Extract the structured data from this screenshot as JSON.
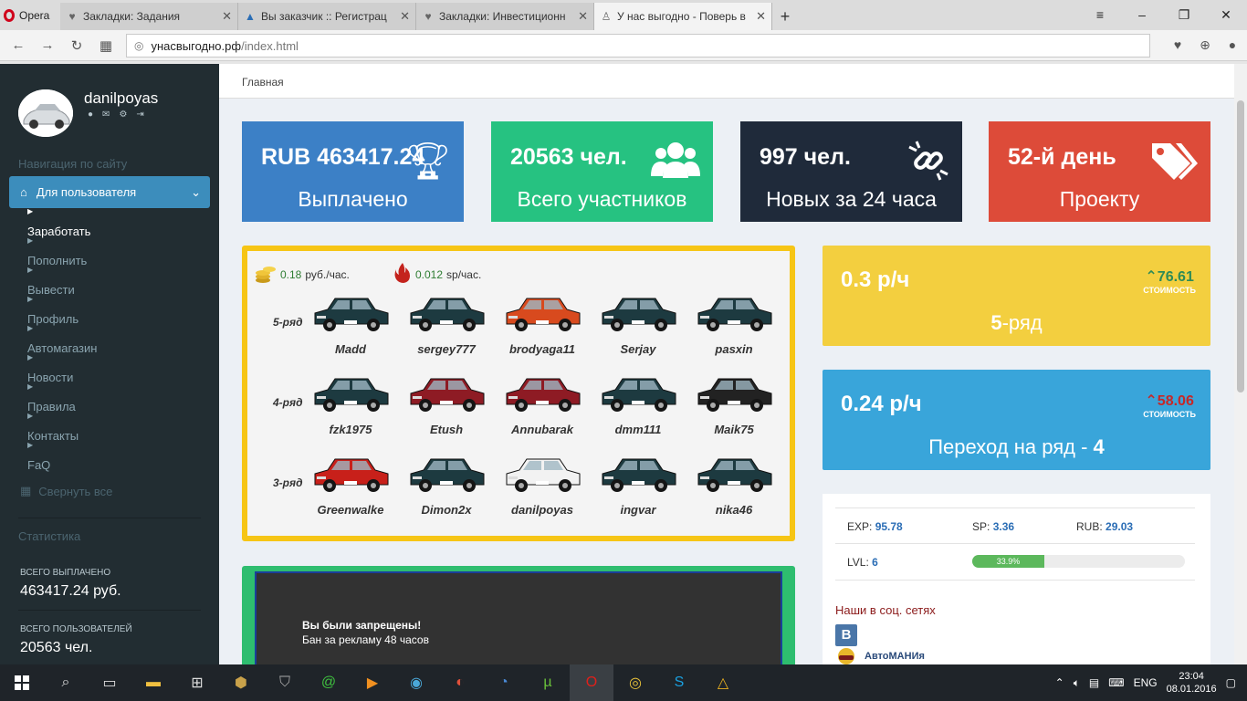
{
  "browser": {
    "menu_label": "Opera",
    "tabs": [
      {
        "title": "Закладки: Задания",
        "icon": "heart-icon"
      },
      {
        "title": "Вы заказчик :: Регистрац",
        "icon": "triangle-icon"
      },
      {
        "title": "Закладки: Инвестиционн",
        "icon": "heart-icon"
      },
      {
        "title": "У нас выгодно - Поверь в",
        "icon": "walker-icon"
      }
    ],
    "url_host": "унасвыгодно.рф",
    "url_path": "/index.html"
  },
  "sidebar": {
    "username": "danilpoyas",
    "nav_heading": "Навигация по сайту",
    "active_group": "Для пользователя",
    "items": [
      "Заработать",
      "Пополнить",
      "Вывести",
      "Профиль",
      "Автомагазин",
      "Новости",
      "Правила",
      "Контакты",
      "FaQ"
    ],
    "collapse_all": "Свернуть все",
    "stats_heading": "Статистика",
    "total_paid_label": "ВСЕГО ВЫПЛАЧЕНО",
    "total_paid_value": "463417.24 руб.",
    "total_users_label": "ВСЕГО ПОЛЬЗОВАТЕЛЕЙ",
    "total_users_value": "20563 чел."
  },
  "breadcrumb": "Главная",
  "kpis": [
    {
      "value": "RUB 463417.24",
      "label": "Выплачено",
      "color": "#3c80c6",
      "icon": "trophy-icon"
    },
    {
      "value": "20563 чел.",
      "label": "Всего участников",
      "color": "#26c281",
      "icon": "users-icon"
    },
    {
      "value": "997 чел.",
      "label": "Новых за 24 часа",
      "color": "#1f2a3a",
      "icon": "link-icon"
    },
    {
      "value": "52-й день",
      "label": "Проекту",
      "color": "#dd4b39",
      "icon": "tags-icon"
    }
  ],
  "rates": {
    "rub": "0.18",
    "rub_unit": "руб./час.",
    "sp": "0.012",
    "sp_unit": "sp/час."
  },
  "rows": [
    {
      "label": "5-ряд",
      "cars": [
        {
          "name": "Madd",
          "color": "#1d3a40"
        },
        {
          "name": "sergey777",
          "color": "#1d3a40"
        },
        {
          "name": "brodyaga11",
          "color": "#d84a1e"
        },
        {
          "name": "Serjay",
          "color": "#1d3a40"
        },
        {
          "name": "pasxin",
          "color": "#1d3a40"
        }
      ]
    },
    {
      "label": "4-ряд",
      "cars": [
        {
          "name": "fzk1975",
          "color": "#1d3a40"
        },
        {
          "name": "Etush",
          "color": "#8e1b24"
        },
        {
          "name": "Annubarak",
          "color": "#8e1b24"
        },
        {
          "name": "dmm111",
          "color": "#1d3a40"
        },
        {
          "name": "Maik75",
          "color": "#222222"
        }
      ]
    },
    {
      "label": "3-ряд",
      "cars": [
        {
          "name": "Greenwalke",
          "color": "#c8201a"
        },
        {
          "name": "Dimon2x",
          "color": "#1d3a40"
        },
        {
          "name": "danilpoyas",
          "color": "#f2f2f2"
        },
        {
          "name": "ingvar",
          "color": "#1d3a40"
        },
        {
          "name": "nika46",
          "color": "#1d3a40"
        }
      ]
    }
  ],
  "row_box": {
    "rate": "0.3 р/ч",
    "cost": "76.61",
    "cost_label": "СТОИМОСТЬ",
    "row_num": "5",
    "row_suffix": "-ряд"
  },
  "next_box": {
    "rate": "0.24 р/ч",
    "cost": "58.06",
    "cost_label": "СТОИМОСТЬ",
    "text": "Переход на ряд - ",
    "row_num": "4"
  },
  "player": {
    "exp_label": "EXP:",
    "exp": "95.78",
    "sp_label": "SP:",
    "sp": "3.36",
    "rub_label": "RUB:",
    "rub": "29.03",
    "lvl_label": "LVL:",
    "lvl": "6",
    "progress_text": "33.9%",
    "progress": 33.9
  },
  "social": {
    "heading": "Наши в соц. сетях",
    "vk": "B",
    "group": "АвтоМАНИя"
  },
  "ban": {
    "title": "Вы были запрещены!",
    "reason": "Бан за рекламу 48 часов"
  },
  "tray": {
    "lang": "ENG",
    "time": "23:04",
    "date": "08.01.2016"
  }
}
